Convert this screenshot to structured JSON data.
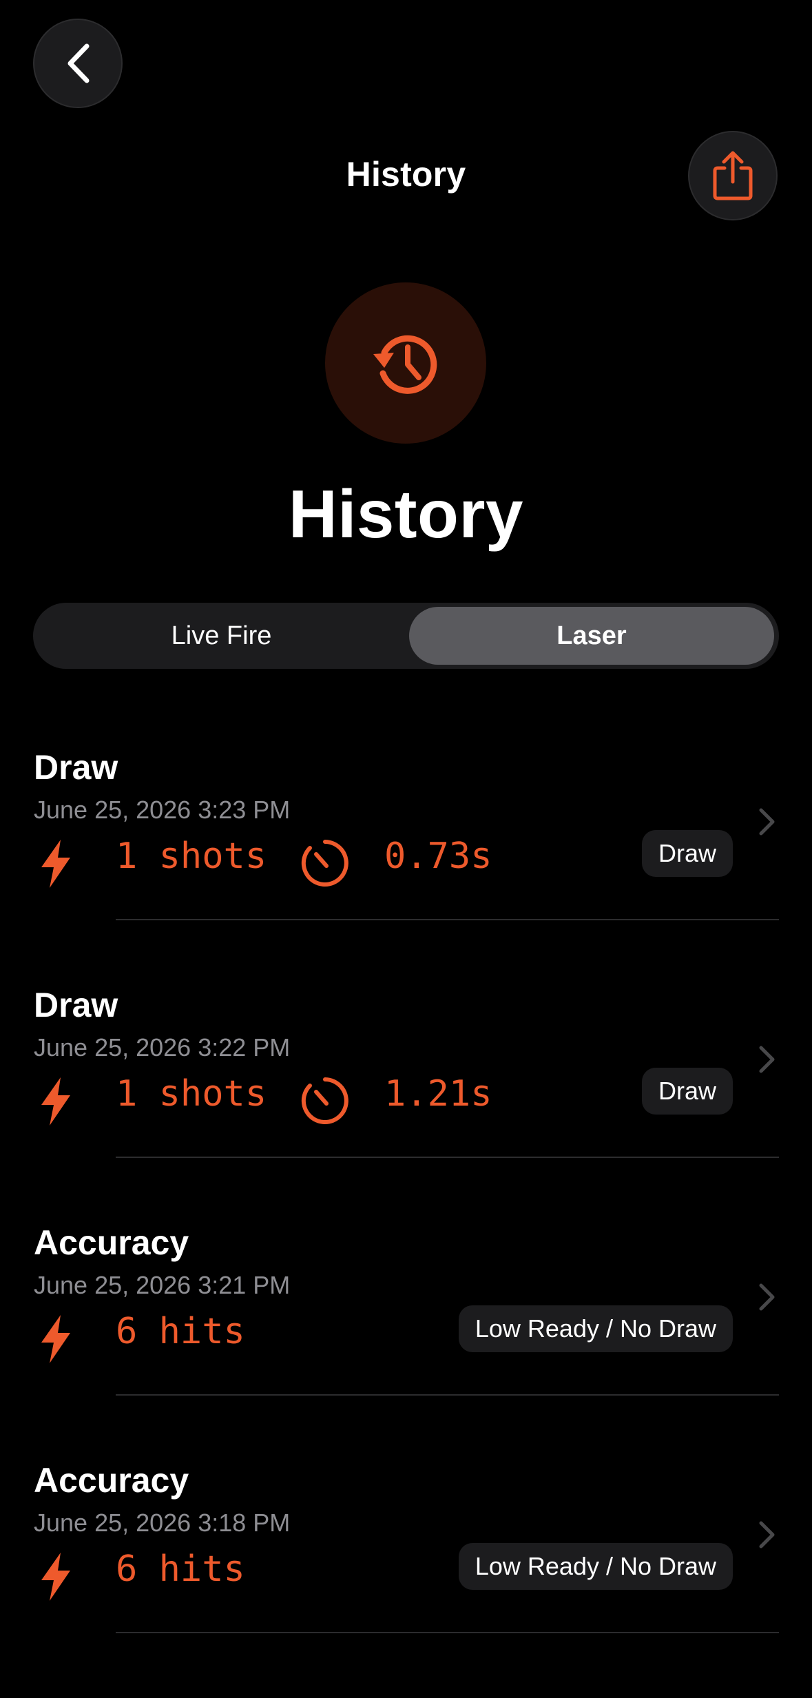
{
  "header": {
    "back_icon": "chevron-left-icon",
    "title": "History",
    "share_icon": "share-icon"
  },
  "hero": {
    "icon": "history-clock-icon",
    "title": "History"
  },
  "segments": {
    "items": [
      "Live Fire",
      "Laser"
    ],
    "selected": "Laser"
  },
  "colors": {
    "accent": "#EE5A2C",
    "background": "#000000",
    "card": "#1C1C1E",
    "secondary_text": "#8E8E93"
  },
  "history": [
    {
      "title": "Draw",
      "date": "June 25, 2026  3:23 PM",
      "count": "1 shots",
      "time": "0.73s",
      "tag": "Draw"
    },
    {
      "title": "Draw",
      "date": "June 25, 2026  3:22 PM",
      "count": "1 shots",
      "time": "1.21s",
      "tag": "Draw"
    },
    {
      "title": "Accuracy",
      "date": "June 25, 2026  3:21 PM",
      "count": "6 hits",
      "time": null,
      "tag": "Low Ready / No Draw"
    },
    {
      "title": "Accuracy",
      "date": "June 25, 2026  3:18 PM",
      "count": "6 hits",
      "time": null,
      "tag": "Low Ready / No Draw"
    }
  ]
}
